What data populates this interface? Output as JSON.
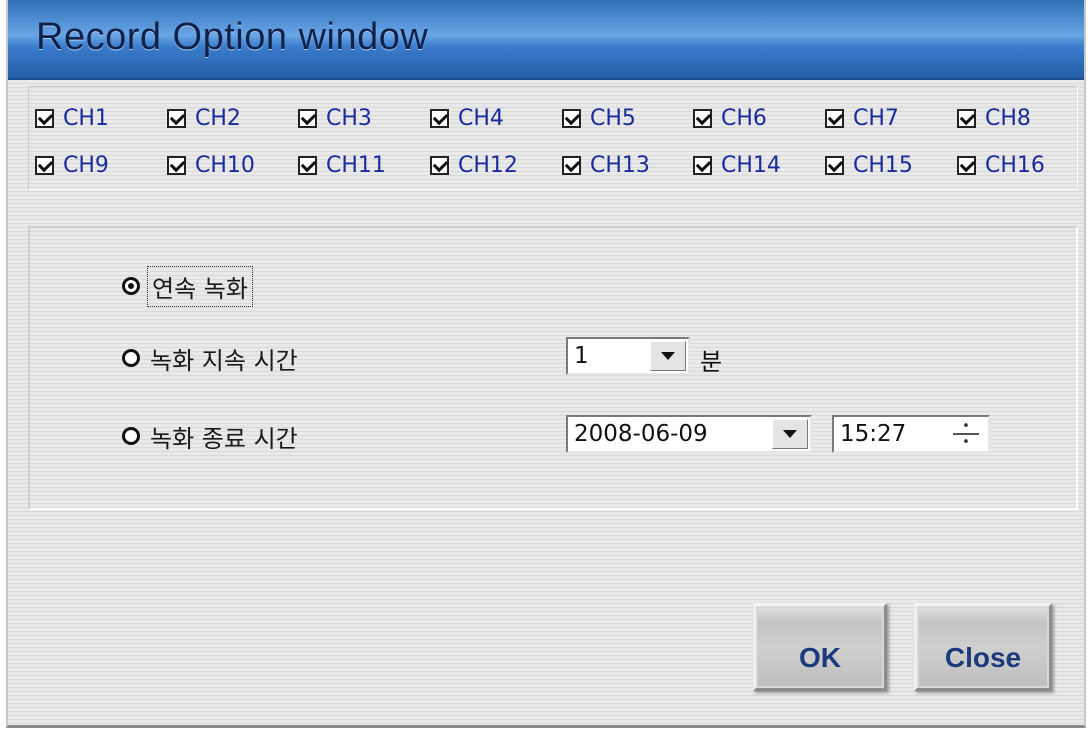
{
  "window": {
    "title": "Record Option window"
  },
  "channels": [
    {
      "label": "CH1",
      "checked": true
    },
    {
      "label": "CH2",
      "checked": true
    },
    {
      "label": "CH3",
      "checked": true
    },
    {
      "label": "CH4",
      "checked": true
    },
    {
      "label": "CH5",
      "checked": true
    },
    {
      "label": "CH6",
      "checked": true
    },
    {
      "label": "CH7",
      "checked": true
    },
    {
      "label": "CH8",
      "checked": true
    },
    {
      "label": "CH9",
      "checked": true
    },
    {
      "label": "CH10",
      "checked": true
    },
    {
      "label": "CH11",
      "checked": true
    },
    {
      "label": "CH12",
      "checked": true
    },
    {
      "label": "CH13",
      "checked": true
    },
    {
      "label": "CH14",
      "checked": true
    },
    {
      "label": "CH15",
      "checked": true
    },
    {
      "label": "CH16",
      "checked": true
    }
  ],
  "record_mode": {
    "options": [
      {
        "label": "연속 녹화",
        "selected": true
      },
      {
        "label": "녹화 지속 시간",
        "selected": false
      },
      {
        "label": "녹화 종료 시간",
        "selected": false
      }
    ],
    "duration": {
      "value": "1",
      "unit": "분"
    },
    "end_date": {
      "value": "2008-06-09"
    },
    "end_time": {
      "value": "15:27"
    }
  },
  "buttons": {
    "ok": "OK",
    "close": "Close"
  }
}
